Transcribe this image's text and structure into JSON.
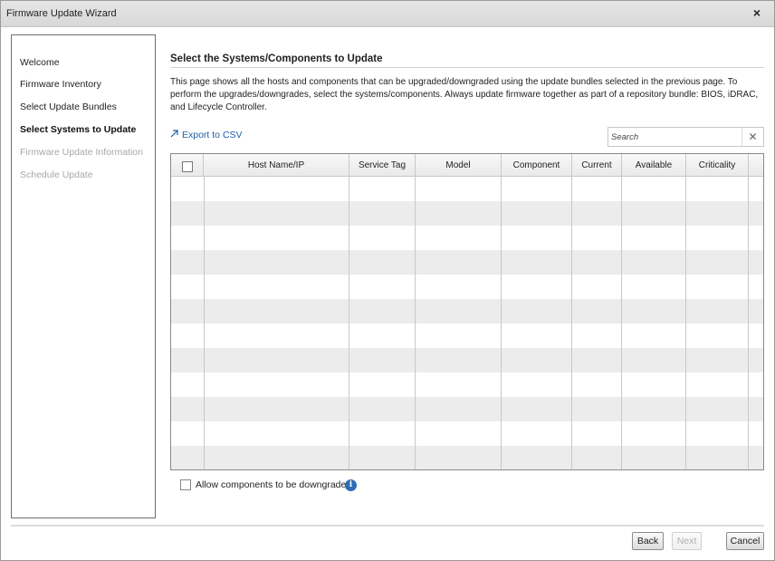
{
  "window": {
    "title": "Firmware Update Wizard",
    "close_glyph": "×"
  },
  "nav": {
    "items": [
      {
        "label": "Welcome",
        "state": "normal"
      },
      {
        "label": "Firmware Inventory",
        "state": "normal"
      },
      {
        "label": "Select Update Bundles",
        "state": "normal"
      },
      {
        "label": "Select Systems to Update",
        "state": "active"
      },
      {
        "label": "Firmware Update Information",
        "state": "disabled"
      },
      {
        "label": "Schedule Update",
        "state": "disabled"
      }
    ]
  },
  "main": {
    "heading": "Select the Systems/Components to Update",
    "description": "This page shows all the hosts and components that can be upgraded/downgraded using the update bundles selected in the previous page. To perform the upgrades/downgrades, select the systems/components. Always update firmware together as part of a repository bundle: BIOS, iDRAC, and Lifecycle Controller.",
    "export_label": "Export to CSV",
    "export_icon": "arrow-up-right-icon",
    "search": {
      "placeholder": "Search",
      "value": "",
      "clear_glyph": "✕"
    },
    "table": {
      "columns": [
        "Host Name/IP",
        "Service Tag",
        "Model",
        "Component",
        "Current",
        "Available",
        "Criticality"
      ],
      "rows": []
    },
    "downgrade_label": "Allow components to be downgraded",
    "info_glyph": "i"
  },
  "footer": {
    "back_label": "Back",
    "next_label": "Next",
    "cancel_label": "Cancel"
  },
  "colors": {
    "link": "#1f5fa8",
    "info_icon": "#2b6fb6",
    "row_alt": "#ececec"
  }
}
